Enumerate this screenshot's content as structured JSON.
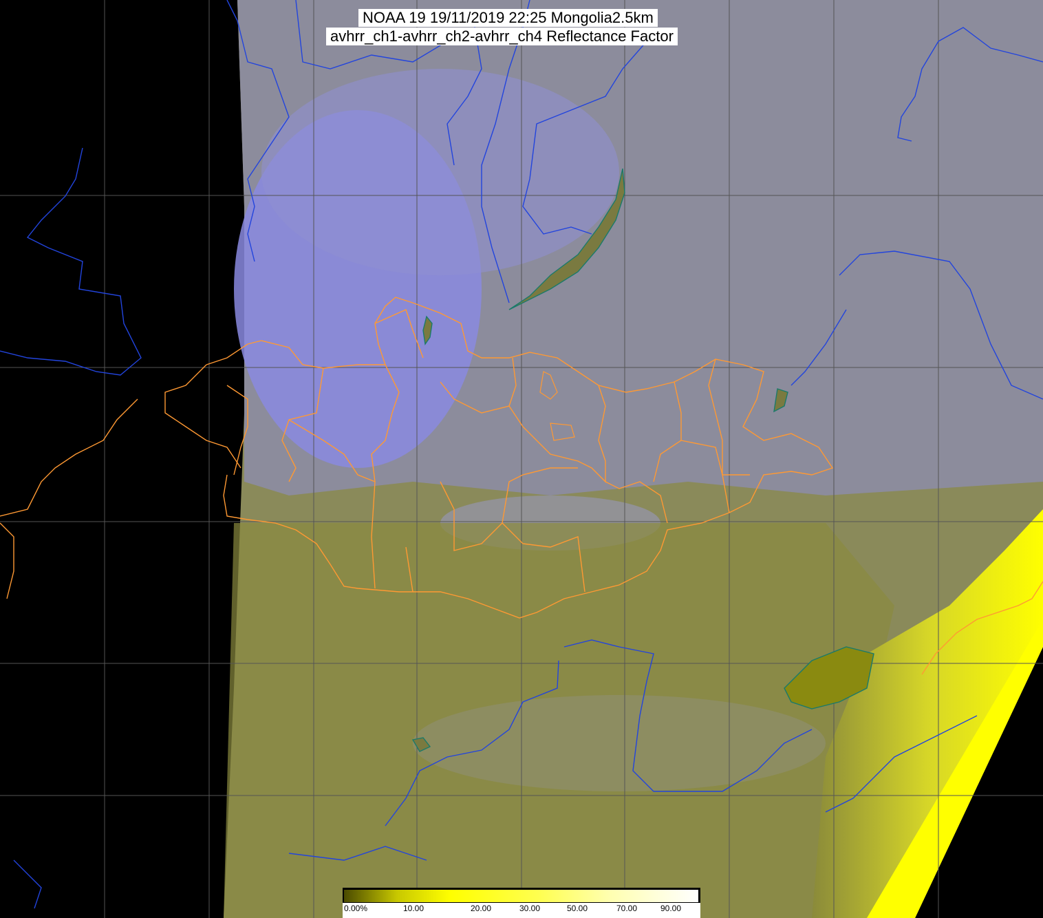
{
  "title": {
    "line1": "NOAA 19 19/11/2019 22:25 Mongolia2.5km",
    "line2": "avhrr_ch1-avhrr_ch2-avhrr_ch4 Reflectance Factor"
  },
  "colorbar": {
    "labels": [
      "0.00%",
      "10.00",
      "20.00",
      "30.00",
      "50.00",
      "70.00",
      "90.00"
    ],
    "colors": [
      "#4a4a00",
      "#c8c800",
      "#ffff00",
      "#ffff40",
      "#ffff90",
      "#ffffd0",
      "#ffffff"
    ]
  },
  "colors": {
    "background": "#000000",
    "land_surface": "#8a8a46",
    "cloud": "#8a8ad8",
    "bright_reflectance": "#ffff00",
    "graticule": "#555555",
    "rivers_coast": "#2244dd",
    "borders": "#ff9933",
    "lakes": "#1a7a6a"
  }
}
